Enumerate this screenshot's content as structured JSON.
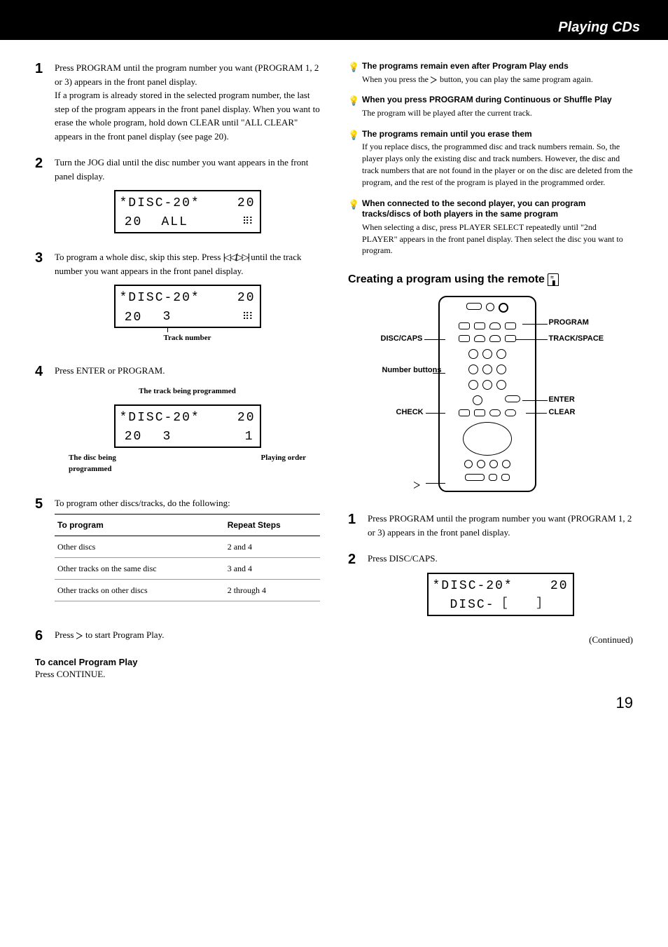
{
  "header": {
    "chapter": "Playing CDs"
  },
  "left": {
    "step1": {
      "num": "1",
      "text_a": "Press PROGRAM until the program number you want (PROGRAM 1, 2 or 3) appears in the front panel display.",
      "text_b": "If a program is already stored in the selected program number, the last step of the program appears in the front panel display. When you want to erase the whole program, hold down CLEAR until \"ALL CLEAR\" appears in the front panel display (see page 20)."
    },
    "step2": {
      "num": "2",
      "text": "Turn the JOG dial until the disc number you want appears in the front panel display.",
      "lcd": {
        "line1_left": "*DISC-20*",
        "line1_right": "20",
        "line2_left": "20",
        "line2_mid": "ALL"
      }
    },
    "step3": {
      "num": "3",
      "text_a": "To program a whole disc, skip this step. Press ",
      "text_b": " until the track number you want appears in the front panel display.",
      "lcd": {
        "line1_left": "*DISC-20*",
        "line1_right": "20",
        "line2_left": "20",
        "line2_mid": "3"
      },
      "caption": "Track number"
    },
    "step4": {
      "num": "4",
      "text": "Press ENTER or PROGRAM.",
      "caption_top": "The track being programmed",
      "lcd": {
        "line1_left": "*DISC-20*",
        "line1_right": "20",
        "line2_left": "20",
        "line2_mid": "3",
        "line2_right": "1"
      },
      "annot_left": "The disc being programmed",
      "annot_right": "Playing order"
    },
    "step5": {
      "num": "5",
      "text": "To program other discs/tracks, do the following:",
      "table": {
        "head": [
          "To program",
          "Repeat Steps"
        ],
        "rows": [
          [
            "Other discs",
            "2 and 4"
          ],
          [
            "Other tracks on the same disc",
            "3 and 4"
          ],
          [
            "Other tracks on other discs",
            "2 through 4"
          ]
        ]
      }
    },
    "step6": {
      "num": "6",
      "text_a": "Press ",
      "text_b": " to start Program Play."
    },
    "cancel": {
      "heading": "To cancel Program Play",
      "text": "Press CONTINUE."
    }
  },
  "right": {
    "tip1": {
      "title": "The programs remain even after Program Play ends",
      "text_a": "When you press the ",
      "text_b": " button, you can play the same program again."
    },
    "tip2": {
      "title": "When you press PROGRAM during Continuous or Shuffle Play",
      "text": "The program will be played after the current track."
    },
    "tip3": {
      "title": "The programs remain until you erase them",
      "text": "If you replace discs, the programmed disc and track numbers remain. So, the player plays only the existing disc and track numbers. However, the disc and track numbers that are not found in the player or on the disc are deleted from the program, and the rest of the program is played in the programmed order."
    },
    "tip4": {
      "title": "When connected to the second player, you can program tracks/discs of both players in the same program",
      "text": "When selecting a disc, press PLAYER SELECT repeatedly until \"2nd PLAYER\" appears in the front panel display. Then select the disc you want to program."
    },
    "section_title": "Creating a program using the remote ",
    "remote_labels": {
      "program": "PROGRAM",
      "disc_caps": "DISC/CAPS",
      "track_space": "TRACK/SPACE",
      "number": "Number buttons",
      "enter": "ENTER",
      "check": "CHECK",
      "clear": "CLEAR",
      "play": "▷"
    },
    "rstep1": {
      "num": "1",
      "text": "Press PROGRAM until the program number you want (PROGRAM 1, 2 or 3) appears in the front panel display."
    },
    "rstep2": {
      "num": "2",
      "text": "Press DISC/CAPS.",
      "lcd": {
        "line1_left": "*DISC-20*",
        "line1_right": "20",
        "line2": "DISC-［　　］"
      }
    },
    "continued": "(Continued)"
  },
  "page_number": "19"
}
